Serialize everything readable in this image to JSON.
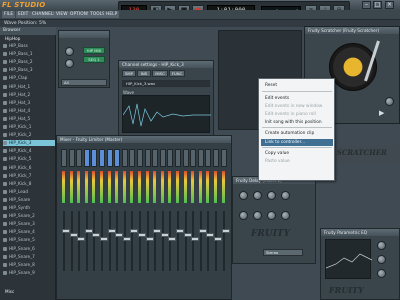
{
  "app": {
    "logo": "FL STUDIO"
  },
  "menus": [
    "FILE",
    "EDIT",
    "CHANNELS",
    "VIEW",
    "OPTIONS",
    "TOOLS",
    "HELP"
  ],
  "hint": {
    "text": "Wave Position: 5%"
  },
  "transport": {
    "bpm": "130",
    "time": "1:01:000",
    "play_icon": "play-icon",
    "stop_icon": "stop-icon",
    "record_icon": "record-icon"
  },
  "browser": {
    "header": "Browser",
    "root": "HipHop",
    "items": [
      "HIP_Bass",
      "HIP_Bass_1",
      "HIP_Bass_2",
      "HIP_Bass_3",
      "HIP_Clap",
      "HIP_Hat_1",
      "HIP_Hat_2",
      "HIP_Hat_3",
      "HIP_Hat_4",
      "HIP_Hat_5",
      "HIP_Kick_1",
      "HIP_Kick_2",
      "HIP_Kick_3",
      "HIP_Kick_4",
      "HIP_Kick_5",
      "HIP_Kick_6",
      "HIP_Kick_7",
      "HIP_Kick_8",
      "HIP_Lead",
      "HIP_Snare",
      "HIP_Synth",
      "HIP_Snare_2",
      "HIP_Snare_3",
      "HIP_Snare_4",
      "HIP_Snare_5",
      "HIP_Snare_6",
      "HIP_Snare_7",
      "HIP_Snare_8",
      "HIP_Snare_9"
    ],
    "selected_index": 12,
    "footer": "Misc"
  },
  "patterns_panel": {
    "label_a": "HIP MIX",
    "label_b": "SEQ 1",
    "dropdown": "All"
  },
  "channel_settings": {
    "title": "Channel settings - HIP_Kick_3",
    "tabs": [
      "SMP",
      "INS",
      "MISC",
      "FUNC"
    ],
    "name_field": "HIP_Kick_3.wav",
    "wave_label": "Wave"
  },
  "mixer": {
    "title": "Mixer - Fruity Limiter (Master)"
  },
  "turntable": {
    "title": "Fruity Scratcher (Fruity Scratcher)"
  },
  "context_menu": {
    "items": [
      {
        "label": "Reset",
        "disabled": false,
        "highlight": false
      },
      {
        "label": "Edit events",
        "disabled": false,
        "highlight": false
      },
      {
        "label": "Edit events in new window",
        "disabled": true,
        "highlight": false
      },
      {
        "label": "Edit events in piano roll",
        "disabled": true,
        "highlight": false
      },
      {
        "label": "Init song with this position",
        "disabled": false,
        "highlight": false
      },
      {
        "label": "Create automation clip",
        "disabled": false,
        "highlight": false
      },
      {
        "label": "Link to controller...",
        "disabled": false,
        "highlight": true
      },
      {
        "label": "Copy value",
        "disabled": false,
        "highlight": false
      },
      {
        "label": "Paste value",
        "disabled": true,
        "highlight": false
      }
    ]
  },
  "scratcher_banner": {
    "text": "FRUITY SCRATCHER"
  },
  "fx_panel_1": {
    "title": "Fruity Delay (Insert 1)",
    "brand": "FRUITY",
    "mode_label": "Stereo"
  },
  "fx_panel_2": {
    "title": "Fruity Parametric EQ",
    "brand": "FRUITY"
  },
  "colors": {
    "accent": "#7cc4d8",
    "menu_highlight": "#3f6f93",
    "logo": "#f0a030"
  }
}
